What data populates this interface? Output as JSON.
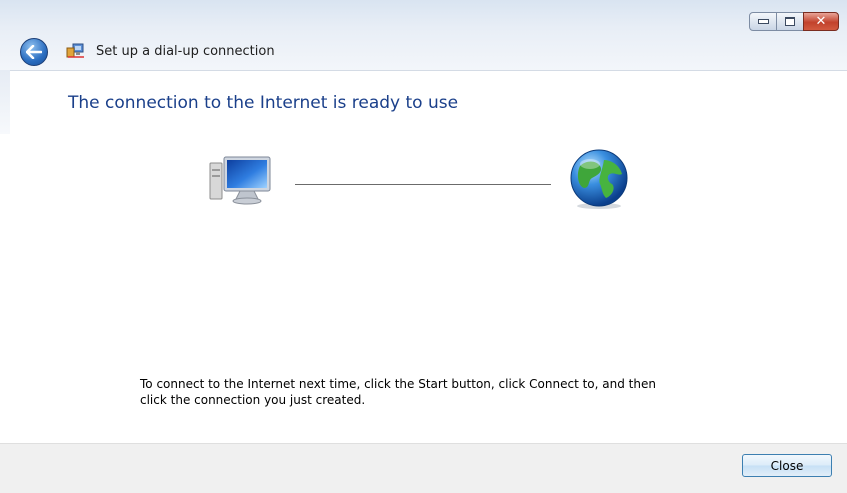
{
  "window": {
    "title": "Set up a dial-up connection",
    "controls": {
      "minimize_icon": "minimize-icon",
      "maximize_icon": "maximize-icon",
      "close_glyph": "✕"
    }
  },
  "main": {
    "heading": "The connection to the Internet is ready to use",
    "instructions": "To connect to the Internet next time, click the Start button, click Connect to, and then click the connection you just created.",
    "diagram": {
      "left_icon": "computer-icon",
      "right_icon": "globe-icon"
    }
  },
  "footer": {
    "close_label": "Close"
  },
  "colors": {
    "heading": "#1a3f8a",
    "accent": "#3c7fb1",
    "close_red": "#c2422c"
  }
}
